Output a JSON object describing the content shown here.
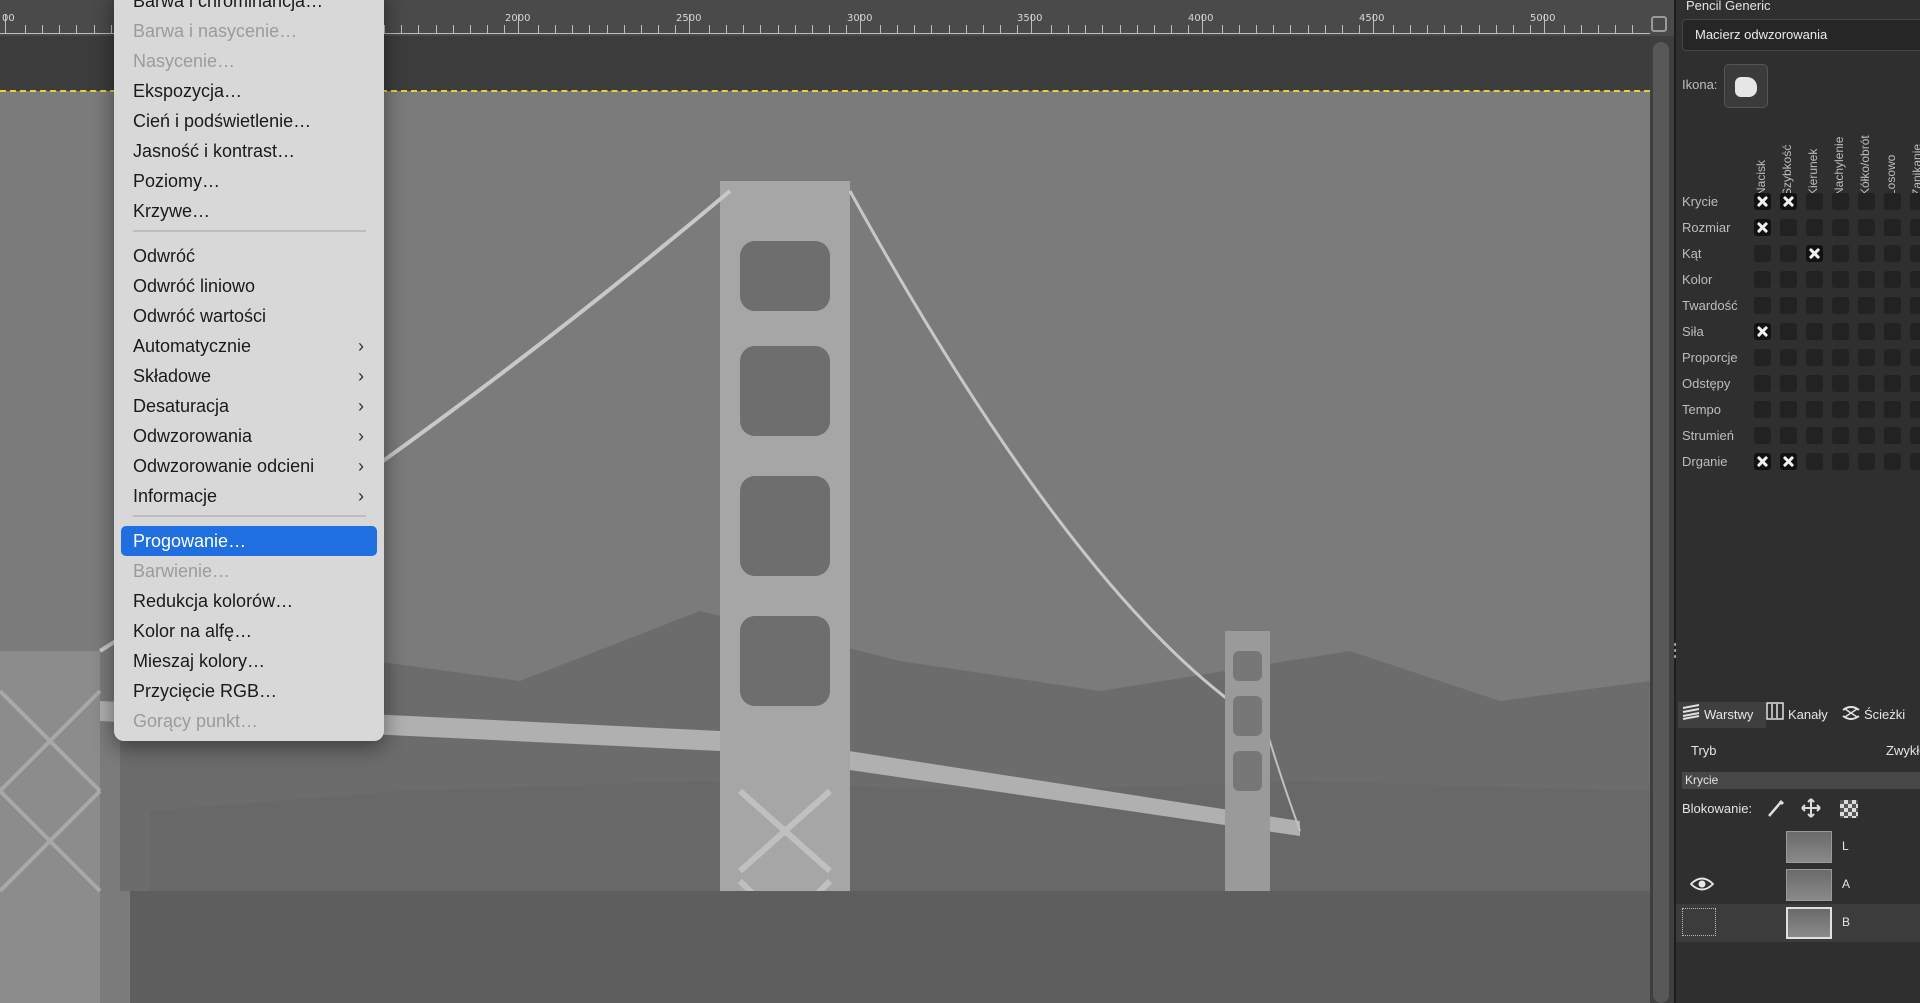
{
  "ruler": {
    "labels": [
      "00",
      "2000",
      "2500",
      "3000",
      "3500",
      "4000",
      "4500",
      "5000"
    ]
  },
  "menu": {
    "items": [
      {
        "label": "Barwa i chrominancja…",
        "disabled": false
      },
      {
        "label": "Barwa i nasycenie…",
        "disabled": true
      },
      {
        "label": "Nasycenie…",
        "disabled": true
      },
      {
        "label": "Ekspozycja…",
        "disabled": false
      },
      {
        "label": "Cień i podświetlenie…",
        "disabled": false
      },
      {
        "label": "Jasność i kontrast…",
        "disabled": false
      },
      {
        "label": "Poziomy…",
        "disabled": false
      },
      {
        "label": "Krzywe…",
        "disabled": false
      },
      {
        "label": "Odwróć",
        "disabled": false
      },
      {
        "label": "Odwróć liniowo",
        "disabled": false
      },
      {
        "label": "Odwróć wartości",
        "disabled": false
      },
      {
        "label": "Automatycznie",
        "disabled": false,
        "submenu": true
      },
      {
        "label": "Składowe",
        "disabled": false,
        "submenu": true
      },
      {
        "label": "Desaturacja",
        "disabled": false,
        "submenu": true
      },
      {
        "label": "Odwzorowania",
        "disabled": false,
        "submenu": true
      },
      {
        "label": "Odwzorowanie odcieni",
        "disabled": false,
        "submenu": true
      },
      {
        "label": "Informacje",
        "disabled": false,
        "submenu": true
      },
      {
        "label": "Progowanie…",
        "disabled": false,
        "selected": true
      },
      {
        "label": "Barwienie…",
        "disabled": true
      },
      {
        "label": "Redukcja kolorów…",
        "disabled": false
      },
      {
        "label": "Kolor na alfę…",
        "disabled": false
      },
      {
        "label": "Mieszaj kolory…",
        "disabled": false
      },
      {
        "label": "Przycięcie RGB…",
        "disabled": false
      },
      {
        "label": "Gorący punkt…",
        "disabled": true
      }
    ],
    "submenu_chevron": "›"
  },
  "dynamics": {
    "title": "Pencil Generic",
    "mapping_label": "Macierz odwzorowania",
    "icon_label": "Ikona:",
    "columns": [
      "Nacisk",
      "Szybkość",
      "Kierunek",
      "Nachylenie",
      "Kółko/obrót",
      "Losowo",
      "Zanikanie"
    ],
    "rows": [
      {
        "label": "Krycie",
        "checks": [
          true,
          true,
          false,
          false,
          false,
          false,
          false
        ]
      },
      {
        "label": "Rozmiar",
        "checks": [
          true,
          false,
          false,
          false,
          false,
          false,
          false
        ]
      },
      {
        "label": "Kąt",
        "checks": [
          false,
          false,
          true,
          false,
          false,
          false,
          false
        ]
      },
      {
        "label": "Kolor",
        "checks": [
          false,
          false,
          false,
          false,
          false,
          false,
          false
        ]
      },
      {
        "label": "Twardość",
        "checks": [
          false,
          false,
          false,
          false,
          false,
          false,
          false
        ]
      },
      {
        "label": "Siła",
        "checks": [
          true,
          false,
          false,
          false,
          false,
          false,
          false
        ]
      },
      {
        "label": "Proporcje",
        "checks": [
          false,
          false,
          false,
          false,
          false,
          false,
          false
        ]
      },
      {
        "label": "Odstępy",
        "checks": [
          false,
          false,
          false,
          false,
          false,
          false,
          false
        ]
      },
      {
        "label": "Tempo",
        "checks": [
          false,
          false,
          false,
          false,
          false,
          false,
          false
        ]
      },
      {
        "label": "Strumień",
        "checks": [
          false,
          false,
          false,
          false,
          false,
          false,
          false
        ]
      },
      {
        "label": "Drganie",
        "checks": [
          true,
          true,
          false,
          false,
          false,
          false,
          false
        ]
      }
    ]
  },
  "layers_panel": {
    "tabs": [
      {
        "label": "Warstwy",
        "icon": "layers-icon"
      },
      {
        "label": "Kanały",
        "icon": "channels-icon"
      },
      {
        "label": "Ścieżki",
        "icon": "paths-icon"
      }
    ],
    "mode_label": "Tryb",
    "mode_value": "Zwykłe",
    "opacity_label": "Krycie",
    "lock_label": "Blokowanie:",
    "layers": [
      {
        "name": "L",
        "visible": false,
        "selected": false
      },
      {
        "name": "A",
        "visible": true,
        "selected": false
      },
      {
        "name": "B",
        "visible": false,
        "selected": true
      }
    ]
  },
  "colors": {
    "selection_highlight": "#1f6fe0",
    "marching_ants": "#e8d03a"
  }
}
